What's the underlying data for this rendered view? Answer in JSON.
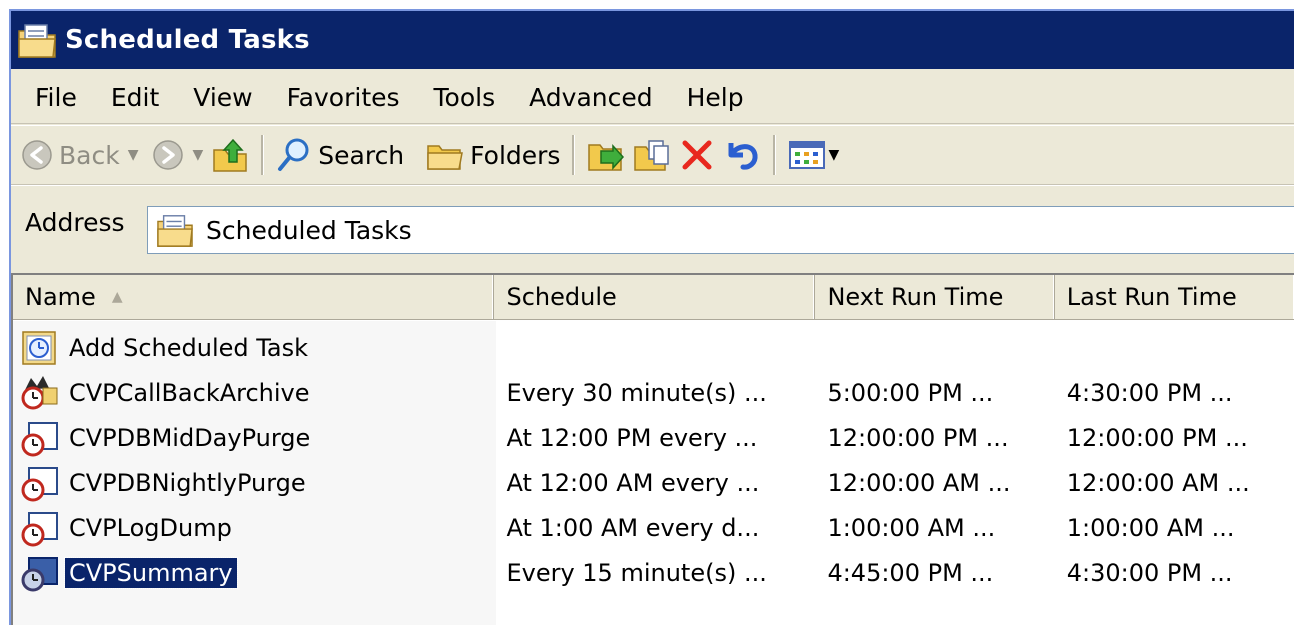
{
  "window": {
    "title": "Scheduled Tasks"
  },
  "menu": {
    "items": [
      "File",
      "Edit",
      "View",
      "Favorites",
      "Tools",
      "Advanced",
      "Help"
    ]
  },
  "toolbar": {
    "back_label": "Back",
    "search_label": "Search",
    "folders_label": "Folders"
  },
  "address": {
    "label": "Address",
    "value": "Scheduled Tasks"
  },
  "list": {
    "columns": {
      "name": "Name",
      "schedule": "Schedule",
      "next_run": "Next Run Time",
      "last_run": "Last Run Time"
    },
    "add_task_label": "Add Scheduled Task",
    "tasks": [
      {
        "name": "CVPCallBackArchive",
        "schedule": "Every 30 minute(s) ...",
        "next_run": "5:00:00 PM ...",
        "last_run": "4:30:00 PM ...",
        "icon": "task-running-icon",
        "selected": false
      },
      {
        "name": "CVPDBMidDayPurge",
        "schedule": "At 12:00 PM every ...",
        "next_run": "12:00:00 PM ...",
        "last_run": "12:00:00 PM ...",
        "icon": "task-clock-icon",
        "selected": false
      },
      {
        "name": "CVPDBNightlyPurge",
        "schedule": "At 12:00 AM every ...",
        "next_run": "12:00:00 AM ...",
        "last_run": "12:00:00 AM ...",
        "icon": "task-clock-icon",
        "selected": false
      },
      {
        "name": "CVPLogDump",
        "schedule": "At 1:00 AM every d...",
        "next_run": "1:00:00 AM ...",
        "last_run": "1:00:00 AM ...",
        "icon": "task-clock-icon",
        "selected": false
      },
      {
        "name": "CVPSummary",
        "schedule": "Every 15 minute(s) ...",
        "next_run": "4:45:00 PM ...",
        "last_run": "4:30:00 PM ...",
        "icon": "task-clock-icon",
        "selected": true
      }
    ]
  },
  "colors": {
    "titlebar": "#0a246a",
    "chrome": "#ece9d8",
    "selection": "#0a246a",
    "delete_red": "#e8281e"
  }
}
